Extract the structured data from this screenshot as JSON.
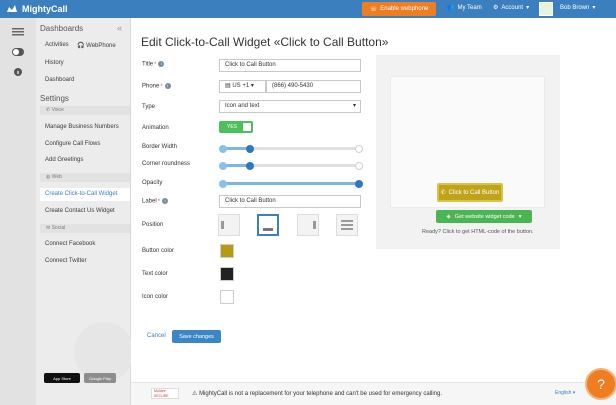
{
  "topbar": {
    "brand": "MightyCall",
    "webphone_button": "Enable webphone",
    "my_team": "My Team",
    "account": "Account",
    "user": "Bob Brown"
  },
  "sidebar": {
    "dashboards_header": "Dashboards",
    "activities": "Activities",
    "webphone": "WebPhone",
    "history": "History",
    "dashboard": "Dashboard",
    "settings_header": "Settings",
    "voice_section": "Voice",
    "manage_numbers": "Manage Business Numbers",
    "configure_flows": "Configure Call Flows",
    "add_greetings": "Add Greetings",
    "web_section": "Web",
    "create_widget": "Create Click-to-Call Widget",
    "create_contact": "Create Contact Us Widget",
    "social_section": "Social",
    "connect_facebook": "Connect Facebook",
    "connect_twitter": "Connect Twitter",
    "app_store": "App Store",
    "google_play": "Google Play"
  },
  "form": {
    "title": "Edit Click-to-Call Widget «Click to Call Button»",
    "title_label": "Title",
    "title_value": "Click to Call Button",
    "phone_label": "Phone",
    "country_code": "US +1",
    "phone_value": "(866) 490-5430",
    "type_label": "Type",
    "type_value": "Icon and text",
    "animation_label": "Animation",
    "animation_value": "YES",
    "border_width_label": "Border Width",
    "border_width_level": 0.2,
    "corner_label": "Corner roundness",
    "corner_level": 0.2,
    "opacity_label": "Opacity",
    "opacity_level": 1.0,
    "label_label": "Label",
    "label_value": "Click to Call Button",
    "position_label": "Position",
    "button_color_label": "Button color",
    "text_color_label": "Text color",
    "icon_color_label": "Icon color",
    "cancel": "Cancel",
    "save": "Save changes"
  },
  "colors": {
    "button_color": "#b59b12",
    "text_color": "#222222",
    "icon_color": "#ffffff",
    "brand_blue": "#3c7fbf",
    "accent_orange": "#ef7d21"
  },
  "preview": {
    "button_label": "Click to Call Button",
    "get_code": "Get website widget code",
    "ready_text": "Ready? Click to get HTML-code of the button."
  },
  "footer": {
    "mcafee": "McAfee SECURE",
    "notice": "MightyCall is not a replacement for your telephone and can't be used for emergency calling.",
    "language": "English",
    "help": "?"
  }
}
